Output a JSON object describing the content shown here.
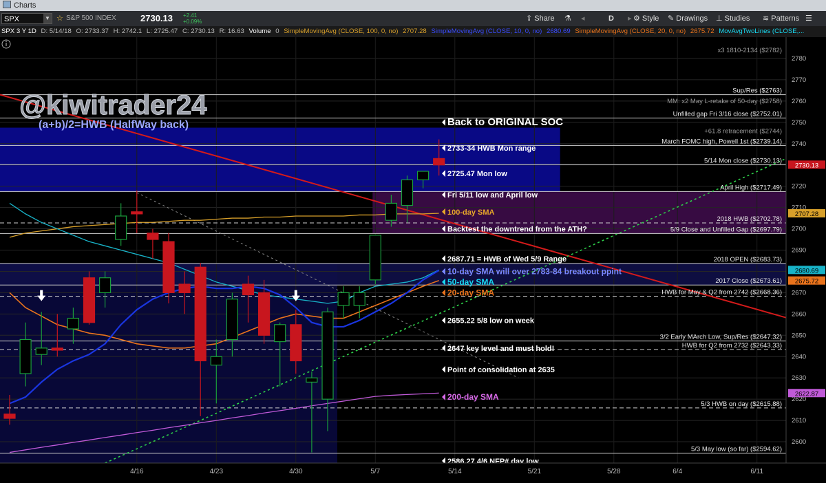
{
  "window": {
    "title": "Charts"
  },
  "toolbar": {
    "symbol": "SPX",
    "description": "S&P 500 INDEX",
    "last": "2730.13",
    "change": "+2.41",
    "change_pct": "+0.09%",
    "share": "Share",
    "aggregation": "D",
    "style": "Style",
    "drawings": "Drawings",
    "studies": "Studies",
    "patterns": "Patterns"
  },
  "studybar": {
    "symbol_period": "SPX 3 Y 1D",
    "date": "D: 5/14/18",
    "open": "O: 2733.37",
    "high": "H: 2742.1",
    "low": "L: 2725.47",
    "close": "C: 2730.13",
    "range": "R: 16.63",
    "volume": "Volume",
    "volume_val": "0",
    "sma100": "SimpleMovingAvg (CLOSE, 100, 0, no)",
    "sma100_val": "2707.28",
    "sma10": "SimpleMovingAvg (CLOSE, 10, 0, no)",
    "sma10_val": "2680.69",
    "sma20": "SimpleMovingAvg (CLOSE, 20, 0, no)",
    "sma20_val": "2675.72",
    "mavg": "MovAvgTwoLines (CLOSE,..."
  },
  "colors": {
    "up": "#1a9e3c",
    "down": "#c8161e",
    "sma10": "#18b3c8",
    "sma20": "#e9731c",
    "sma50": "#1a35e0",
    "sma100": "#d8a02a",
    "sma200": "#c05ad8",
    "trend": "#d41a1a",
    "dotted": "#2ed24a",
    "watermark": "#9a9ea8",
    "hwb": "#9aa6ff"
  },
  "chart_data": {
    "type": "candlestick",
    "ylim": [
      2590,
      2790
    ],
    "y_ticks": [
      2600,
      2610,
      2620,
      2630,
      2640,
      2650,
      2660,
      2670,
      2680,
      2690,
      2700,
      2710,
      2720,
      2730,
      2740,
      2750,
      2760,
      2770,
      2780
    ],
    "x_tick_labels": [
      {
        "label": "4/16",
        "day": 8
      },
      {
        "label": "4/23",
        "day": 13
      },
      {
        "label": "4/30",
        "day": 18
      },
      {
        "label": "5/7",
        "day": 23
      },
      {
        "label": "5/14",
        "day": 28
      },
      {
        "label": "5/21",
        "day": 33
      },
      {
        "label": "5/28",
        "day": 38
      },
      {
        "label": "6/4",
        "day": 42
      },
      {
        "label": "6/11",
        "day": 47
      }
    ],
    "candles": [
      {
        "day": 0,
        "o": 2613,
        "h": 2622,
        "l": 2608,
        "c": 2611
      },
      {
        "day": 1,
        "o": 2632,
        "h": 2656,
        "l": 2626,
        "c": 2648
      },
      {
        "day": 2,
        "o": 2641,
        "h": 2661,
        "l": 2636,
        "c": 2644
      },
      {
        "day": 3,
        "o": 2644,
        "h": 2660,
        "l": 2640,
        "c": 2643
      },
      {
        "day": 4,
        "o": 2653,
        "h": 2663,
        "l": 2646,
        "c": 2658
      },
      {
        "day": 5,
        "o": 2677,
        "h": 2680,
        "l": 2655,
        "c": 2656
      },
      {
        "day": 6,
        "o": 2670,
        "h": 2680,
        "l": 2663,
        "c": 2677
      },
      {
        "day": 7,
        "o": 2695,
        "h": 2712,
        "l": 2692,
        "c": 2706
      },
      {
        "day": 8,
        "o": 2708,
        "h": 2718,
        "l": 2698,
        "c": 2707
      },
      {
        "day": 9,
        "o": 2698,
        "h": 2700,
        "l": 2686,
        "c": 2695
      },
      {
        "day": 10,
        "o": 2694,
        "h": 2698,
        "l": 2665,
        "c": 2670
      },
      {
        "day": 11,
        "o": 2674,
        "h": 2680,
        "l": 2660,
        "c": 2670
      },
      {
        "day": 12,
        "o": 2682,
        "h": 2684,
        "l": 2612,
        "c": 2638
      },
      {
        "day": 13,
        "o": 2636,
        "h": 2648,
        "l": 2618,
        "c": 2640
      },
      {
        "day": 14,
        "o": 2648,
        "h": 2670,
        "l": 2640,
        "c": 2667
      },
      {
        "day": 15,
        "o": 2674,
        "h": 2678,
        "l": 2656,
        "c": 2669
      },
      {
        "day": 16,
        "o": 2670,
        "h": 2676,
        "l": 2646,
        "c": 2650
      },
      {
        "day": 17,
        "o": 2647,
        "h": 2656,
        "l": 2626,
        "c": 2655
      },
      {
        "day": 18,
        "o": 2655,
        "h": 2662,
        "l": 2632,
        "c": 2638
      },
      {
        "day": 19,
        "o": 2628,
        "h": 2633,
        "l": 2595,
        "c": 2630
      },
      {
        "day": 20,
        "o": 2620,
        "h": 2663,
        "l": 2605,
        "c": 2661
      },
      {
        "day": 21,
        "o": 2664,
        "h": 2673,
        "l": 2658,
        "c": 2670
      },
      {
        "day": 22,
        "o": 2664,
        "h": 2673,
        "l": 2658,
        "c": 2670
      },
      {
        "day": 23,
        "o": 2676,
        "h": 2697,
        "l": 2674,
        "c": 2697
      },
      {
        "day": 24,
        "o": 2704,
        "h": 2716,
        "l": 2701,
        "c": 2712
      },
      {
        "day": 25,
        "o": 2711,
        "h": 2725,
        "l": 2703,
        "c": 2723
      },
      {
        "day": 26,
        "o": 2723,
        "h": 2727,
        "l": 2719,
        "c": 2727
      },
      {
        "day": 27,
        "o": 2733,
        "h": 2742,
        "l": 2725,
        "c": 2730
      }
    ],
    "price_labels": [
      {
        "label": "x3 1810-2134 ($2782)",
        "price": 2782,
        "line": false
      },
      {
        "label": "Sup/Res ($2763)",
        "price": 2763,
        "line": true
      },
      {
        "label": "MM: x2 May L-retake of 50-day ($2758)",
        "price": 2758,
        "line": false
      },
      {
        "label": "Unfilled gap Fri 3/16 close ($2752.01)",
        "price": 2752.01,
        "line": true
      },
      {
        "label": "+61.8 retracement ($2744)",
        "price": 2744,
        "line": false
      },
      {
        "label": "March FOMC high, Powell 1st ($2739.14)",
        "price": 2739.14,
        "line": true
      },
      {
        "label": "5/14 Mon close ($2730.13)",
        "price": 2730.13,
        "line": true
      },
      {
        "label": "April High ($2717.49)",
        "price": 2717.49,
        "line": true
      },
      {
        "label": "2018 HWB ($2702.78)",
        "price": 2702.78,
        "line": true
      },
      {
        "label": "5/9 Close and Unfilled Gap ($2697.79)",
        "price": 2697.79,
        "line": true
      },
      {
        "label": "2018 OPEN ($2683.73)",
        "price": 2683.73,
        "line": true
      },
      {
        "label": "2017 Close ($2673.61)",
        "price": 2673.61,
        "line": true
      },
      {
        "label": "HWB for May & Q2 from 2742 ($2668.36)",
        "price": 2668.36,
        "line": true
      },
      {
        "label": "3/2 Early MArch Low, Sup/Res ($2647.32)",
        "price": 2647.32,
        "line": true
      },
      {
        "label": "HWB for Q2 from 2732 ($2643.33)",
        "price": 2643.33,
        "line": true
      },
      {
        "label": "5/3 HWB on day ($2615.88)",
        "price": 2615.88,
        "line": true
      },
      {
        "label": "5/3 May low (so far) ($2594.62)",
        "price": 2594.62,
        "line": true
      }
    ],
    "axis_badges": [
      {
        "label": "2730.13",
        "price": 2730.13,
        "bg": "#c8161e",
        "fg": "#ffffff"
      },
      {
        "label": "2707.28",
        "price": 2707.28,
        "bg": "#d8a02a",
        "fg": "#000000"
      },
      {
        "label": "2680.69",
        "price": 2680.69,
        "bg": "#18b3c8",
        "fg": "#000000"
      },
      {
        "label": "2675.72",
        "price": 2675.72,
        "bg": "#e9731c",
        "fg": "#000000"
      },
      {
        "label": "2622.87",
        "price": 2622.87,
        "bg": "#c05ad8",
        "fg": "#000000"
      }
    ],
    "annotations": [
      {
        "label": "Back to ORIGINAL SOC",
        "price": 2750,
        "color": "#ffffff",
        "size": 15
      },
      {
        "label": "2733-34 HWB Mon range",
        "price": 2738,
        "color": "#ffffff",
        "size": 11
      },
      {
        "label": "2725.47 Mon low",
        "price": 2726,
        "color": "#ffffff",
        "size": 11
      },
      {
        "label": "Fri 5/11 low and April low",
        "price": 2716,
        "color": "#ffffff",
        "size": 11
      },
      {
        "label": "100-day SMA",
        "price": 2708,
        "color": "#e5a52a",
        "size": 11
      },
      {
        "label": "Backtest the downtrend from the ATH?",
        "price": 2700,
        "color": "#ffffff",
        "size": 11
      },
      {
        "label": "2687.71 = HWB of Wed 5/9 Range",
        "price": 2686,
        "color": "#ffffff",
        "size": 11
      },
      {
        "label": "10-day SMA will  over 2783-84 breakout ppint",
        "price": 2680,
        "color": "#7a88ff",
        "size": 12
      },
      {
        "label": "50-day SMA",
        "price": 2675,
        "color": "#18d8f0",
        "size": 12
      },
      {
        "label": "20-day SMA",
        "price": 2670,
        "color": "#e9731c",
        "size": 12
      },
      {
        "label": "2655.22 5/8 low on week",
        "price": 2657,
        "color": "#ffffff",
        "size": 11
      },
      {
        "label": "2647 key level and must hold!",
        "price": 2644,
        "color": "#ffffff",
        "size": 11
      },
      {
        "label": "Point of consolidation at 2635",
        "price": 2634,
        "color": "#ffffff",
        "size": 11
      },
      {
        "label": "200-day SMA",
        "price": 2621,
        "color": "#d86ae8",
        "size": 12
      },
      {
        "label": "2586.27 4/6 NFP# day low",
        "price": 2591,
        "color": "#ffffff",
        "size": 11
      }
    ],
    "watermark": "@kiwitrader24",
    "hwb_title": "(a+b)/2=HWB (HalfWay back)",
    "sma10": [
      2712,
      2707,
      2703,
      2700,
      2697,
      2694,
      2692,
      2690,
      2688,
      2686,
      2684,
      2681,
      2678,
      2675,
      2673,
      2671,
      2669,
      2668,
      2667,
      2666,
      2665,
      2666,
      2670,
      2673,
      2674,
      2675,
      2677,
      2680.69
    ],
    "sma20": [
      2670,
      2663,
      2659,
      2655,
      2653,
      2651,
      2650,
      2648,
      2646,
      2645,
      2644,
      2644,
      2645,
      2646,
      2649,
      2652,
      2655,
      2658,
      2660,
      2659,
      2658,
      2658,
      2661,
      2664,
      2667,
      2670,
      2673,
      2675.72
    ],
    "sma50": [
      2618,
      2621,
      2628,
      2634,
      2638,
      2641,
      2646,
      2655,
      2662,
      2667,
      2670,
      2672,
      2673,
      2672,
      2672,
      2673,
      2672,
      2669,
      2663,
      2656,
      2654,
      2654,
      2657,
      2661,
      2665,
      2670,
      2676,
      2680.5
    ],
    "sma100": [
      2696,
      2698,
      2699,
      2700,
      2701,
      2701.5,
      2702,
      2702.5,
      2703,
      2703,
      2703.5,
      2704,
      2704,
      2704.5,
      2705,
      2705,
      2705.5,
      2705.5,
      2706,
      2706,
      2706,
      2706,
      2706.5,
      2706.5,
      2707,
      2707,
      2707,
      2707.28
    ],
    "sma200": [
      2595,
      2596.2,
      2597.4,
      2598.5,
      2599.7,
      2600.8,
      2602,
      2603.1,
      2604.3,
      2605.4,
      2606.6,
      2607.7,
      2608.9,
      2610,
      2611.2,
      2612.3,
      2613.5,
      2614.6,
      2615.7,
      2616.9,
      2618,
      2619.1,
      2620.2,
      2621.3,
      2621.8,
      2622.2,
      2622.5,
      2622.87
    ]
  }
}
